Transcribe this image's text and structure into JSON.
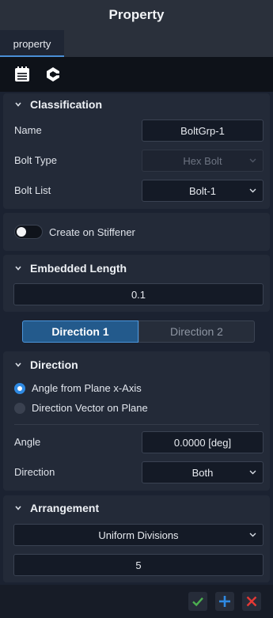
{
  "panel": {
    "title": "Property"
  },
  "tabs": [
    {
      "label": "property"
    }
  ],
  "toolbar": {
    "icons": [
      "notes-icon",
      "bolt-logo-icon"
    ]
  },
  "classification": {
    "header": "Classification",
    "name_label": "Name",
    "name_value": "BoltGrp-1",
    "bolt_type_label": "Bolt Type",
    "bolt_type_value": "Hex Bolt",
    "bolt_list_label": "Bolt List",
    "bolt_list_value": "Bolt-1"
  },
  "stiffener": {
    "label": "Create on Stiffener",
    "enabled": false
  },
  "embedded": {
    "header": "Embedded Length",
    "value": "0.1"
  },
  "direction_tabs": [
    {
      "label": "Direction 1",
      "active": true
    },
    {
      "label": "Direction 2",
      "active": false
    }
  ],
  "direction": {
    "header": "Direction",
    "options": [
      {
        "label": "Angle from Plane x-Axis",
        "selected": true
      },
      {
        "label": "Direction Vector on Plane",
        "selected": false
      }
    ],
    "angle_label": "Angle",
    "angle_value": "0.0000 [deg]",
    "direction_label": "Direction",
    "direction_value": "Both"
  },
  "arrangement": {
    "header": "Arrangement",
    "type_value": "Uniform Divisions",
    "count_value": "5"
  },
  "colors": {
    "accent": "#2f8ae3",
    "ok": "#4caf50",
    "add": "#2f8ae3",
    "cancel": "#e53935"
  }
}
